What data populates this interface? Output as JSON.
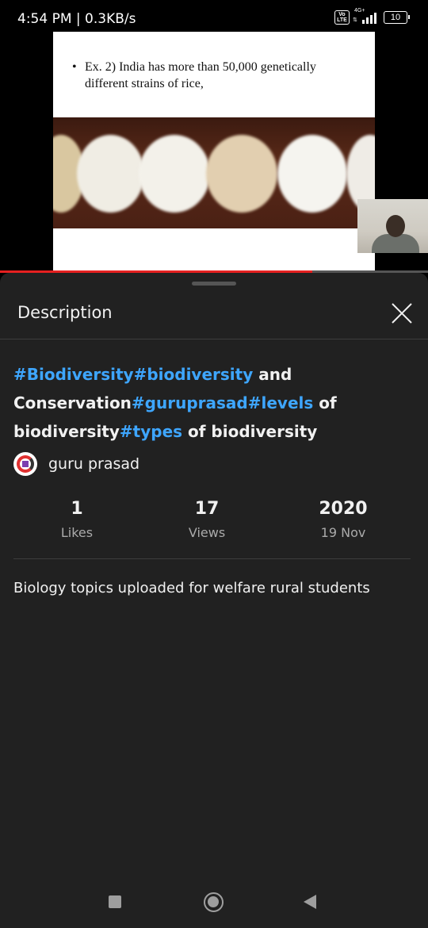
{
  "status_bar": {
    "time_speed": "4:54 PM | 0.3KB/s",
    "volte": "Vo LTE",
    "network": "4G+",
    "battery": "10"
  },
  "video": {
    "slide_bullet": "•",
    "slide_text": "Ex. 2) India has more than 50,000 genetically different strains of rice,",
    "progress": 0.73
  },
  "panel": {
    "title": "Description",
    "close_icon": "close-icon"
  },
  "video_title": {
    "parts": [
      {
        "text": "#Biodiversity",
        "hashtag": true
      },
      {
        "text": "#biodiversity",
        "hashtag": true
      },
      {
        "text": " and Conservation",
        "hashtag": false
      },
      {
        "text": "#guruprasad",
        "hashtag": true
      },
      {
        "text": "#levels",
        "hashtag": true
      },
      {
        "text": " of biodiversity",
        "hashtag": false
      },
      {
        "text": "#types",
        "hashtag": true
      },
      {
        "text": " of biodiversity",
        "hashtag": false
      }
    ]
  },
  "channel": {
    "name": "guru prasad",
    "avatar_icon": "channel-logo-icon"
  },
  "stats": {
    "likes_value": "1",
    "likes_label": "Likes",
    "views_value": "17",
    "views_label": "Views",
    "year_value": "2020",
    "date_label": "19 Nov"
  },
  "description": {
    "text": "Biology topics uploaded for welfare rural students"
  },
  "navbar": {
    "recent_icon": "square-icon",
    "home_icon": "circle-icon",
    "back_icon": "triangle-back-icon"
  },
  "colors": {
    "hashtag": "#3ea6ff",
    "panel_bg": "#212121",
    "progress": "#e52020"
  }
}
